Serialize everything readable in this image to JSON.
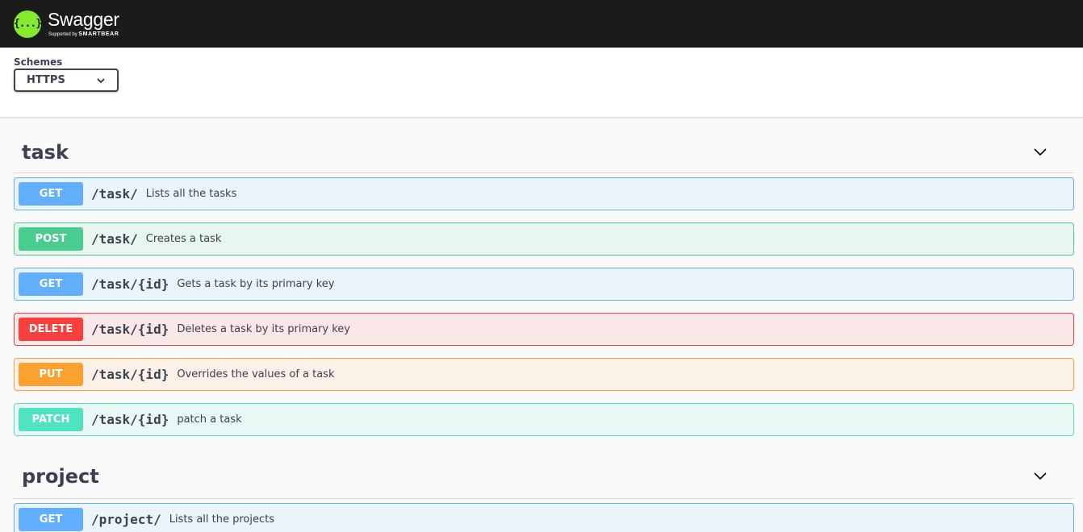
{
  "topbar": {
    "brand": "Swagger",
    "brand_icon": "{...}",
    "supported_by": "Supported by",
    "supporter": "SMARTBEAR"
  },
  "schemes": {
    "label": "Schemes",
    "selected": "HTTPS"
  },
  "colors": {
    "GET": "#61affe",
    "POST": "#49cc90",
    "DELETE": "#f93e3e",
    "PUT": "#fca130",
    "PATCH": "#50e3c2",
    "topbar": "#1b1b1b",
    "logo": "#85ea2d"
  },
  "tags": [
    {
      "name": "task",
      "operations": [
        {
          "method": "GET",
          "path": "/task/",
          "summary": "Lists all the tasks"
        },
        {
          "method": "POST",
          "path": "/task/",
          "summary": "Creates a task"
        },
        {
          "method": "GET",
          "path": "/task/{id}",
          "summary": "Gets a task by its primary key"
        },
        {
          "method": "DELETE",
          "path": "/task/{id}",
          "summary": "Deletes a task by its primary key"
        },
        {
          "method": "PUT",
          "path": "/task/{id}",
          "summary": "Overrides the values of a task"
        },
        {
          "method": "PATCH",
          "path": "/task/{id}",
          "summary": "patch a task"
        }
      ]
    },
    {
      "name": "project",
      "operations": [
        {
          "method": "GET",
          "path": "/project/",
          "summary": "Lists all the projects"
        }
      ]
    }
  ]
}
